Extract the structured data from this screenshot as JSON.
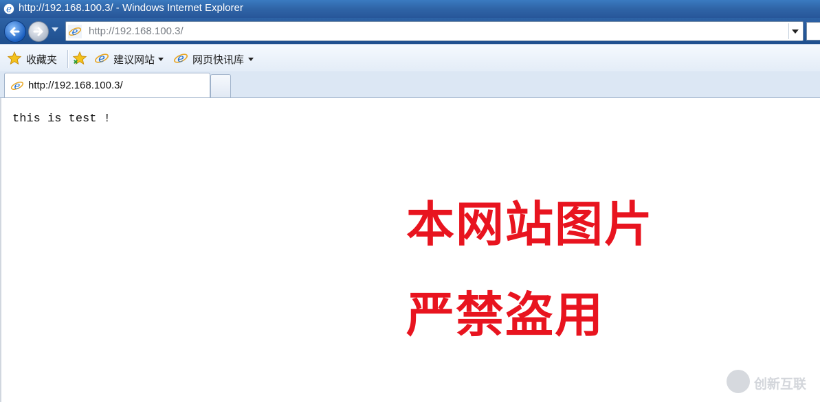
{
  "window": {
    "title": "http://192.168.100.3/ - Windows Internet Explorer"
  },
  "navigation": {
    "address_url": "http://192.168.100.3/"
  },
  "favorites_bar": {
    "favorites_label": "收藏夹",
    "suggested_sites_label": "建议网站",
    "web_slices_label": "网页快讯库"
  },
  "tabs": [
    {
      "label": "http://192.168.100.3/"
    }
  ],
  "page": {
    "body_text": "this is test !"
  },
  "overlay": {
    "line1": "本网站图片",
    "line2": "严禁盗用"
  },
  "watermark": {
    "text": "创新互联"
  },
  "colors": {
    "warning_red": "#e8141f",
    "titlebar_blue": "#2f64a6"
  },
  "icons": [
    "ie-icon",
    "back-icon",
    "forward-icon",
    "star-icon",
    "add-favorite-icon"
  ]
}
